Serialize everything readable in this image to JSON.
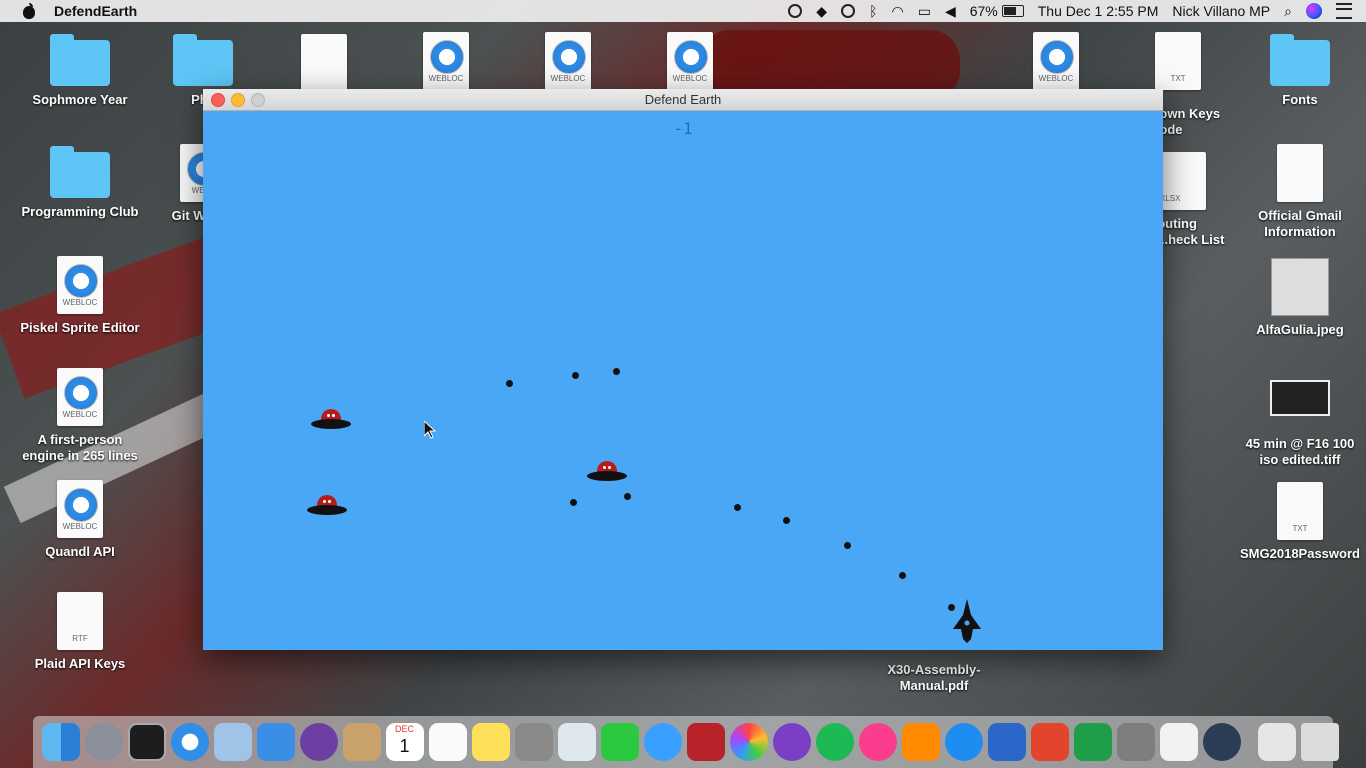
{
  "menubar": {
    "app_name": "DefendEarth",
    "battery": "67%",
    "datetime": "Thu Dec 1  2:55 PM",
    "user": "Nick Villano MP"
  },
  "desktop": {
    "icons": [
      {
        "label": "Sophmore Year",
        "kind": "folder"
      },
      {
        "label": "Phy",
        "kind": "folder"
      },
      {
        "label": "",
        "kind": "document"
      },
      {
        "label": "",
        "kind": "webloc",
        "tag": "WEBLOC"
      },
      {
        "label": "",
        "kind": "webloc",
        "tag": "WEBLOC"
      },
      {
        "label": "",
        "kind": "webloc",
        "tag": "WEBLOC"
      },
      {
        "label": "",
        "kind": "webloc",
        "tag": "WEBLOC"
      },
      {
        "label": "",
        "kind": "txt",
        "tag": "TXT"
      },
      {
        "label": "Fonts",
        "kind": "folder"
      },
      {
        "label": "Programming Club",
        "kind": "folder"
      },
      {
        "label": "Git With N",
        "kind": "webloc",
        "tag": "WEBL"
      },
      {
        "label": "Down Keys Code",
        "kind": "partial"
      },
      {
        "label": "couting e...heck List",
        "kind": "xlsx",
        "tag": "XLSX"
      },
      {
        "label": "Official Gmail Information",
        "kind": "document"
      },
      {
        "label": "Piskel Sprite Editor",
        "kind": "webloc",
        "tag": "WEBLOC"
      },
      {
        "label": "AlfaGulia.jpeg",
        "kind": "image"
      },
      {
        "label": "A first-person engine in 265 lines",
        "kind": "webloc",
        "tag": "WEBLOC"
      },
      {
        "label": "45 min @ F16 100 iso edited.tiff",
        "kind": "image-dark"
      },
      {
        "label": "Quandl API",
        "kind": "webloc",
        "tag": "WEBLOC"
      },
      {
        "label": "SMG2018Password",
        "kind": "txt",
        "tag": "TXT"
      },
      {
        "label": "Plaid API Keys",
        "kind": "rtf",
        "tag": "RTF"
      },
      {
        "label": "X30-Assembly-Manual.pdf",
        "kind": "pdf"
      }
    ]
  },
  "window": {
    "title": "Defend Earth",
    "score": "-1",
    "background_color": "#4aa7f5"
  },
  "dock": {
    "apps": [
      "finder-icon",
      "launchpad-icon",
      "terminal-icon",
      "safari-icon",
      "box-icon",
      "xcode-icon",
      "github-icon",
      "contacts-icon",
      "calendar-icon",
      "reminders-icon",
      "notes-icon",
      "calculator-icon",
      "preview-icon",
      "facetime-icon",
      "messages-icon",
      "photo-booth-icon",
      "photos-icon",
      "imovie-icon",
      "spotify-icon",
      "itunes-icon",
      "ibooks-icon",
      "app-store-icon",
      "word-icon",
      "powerpoint-icon",
      "excel-icon",
      "system-preferences-icon",
      "java-icon",
      "quicktime-icon"
    ],
    "calendar_month": "DEC",
    "calendar_day": "1"
  }
}
